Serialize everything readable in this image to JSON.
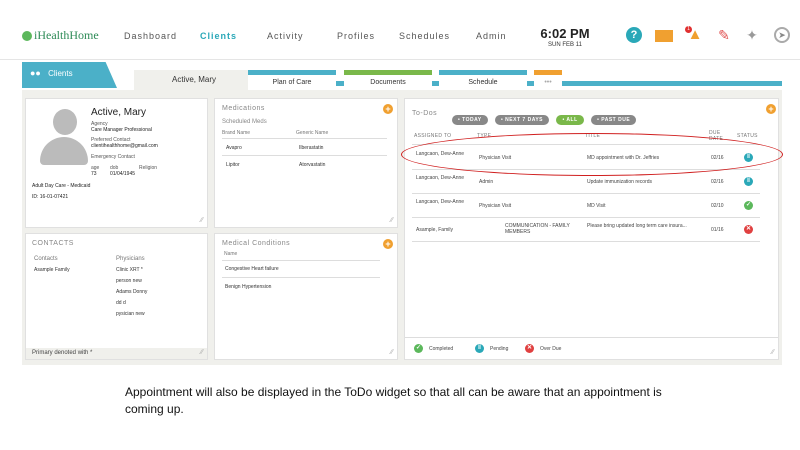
{
  "app": {
    "logo": "iHealthHome"
  },
  "nav": {
    "items": [
      "Dashboard",
      "Clients",
      "Activity",
      "Profiles",
      "Schedules",
      "Admin"
    ],
    "active": "Clients"
  },
  "clock": {
    "time": "6:02 PM",
    "date": "SUN FEB 11"
  },
  "notifications": {
    "bell_count": "1"
  },
  "tabs": {
    "clients": "Clients",
    "active_client": "Active, Mary",
    "subtabs": [
      {
        "label": "Plan of Care",
        "color": "#4bb0c8"
      },
      {
        "label": "Documents",
        "color": "#7ab84a"
      },
      {
        "label": "Schedule",
        "color": "#4bb0c8"
      },
      {
        "label": "•••",
        "color": "#f0a030"
      }
    ]
  },
  "profile": {
    "name": "Active, Mary",
    "agency_label": "Agency",
    "agency": "Care Manager Professional",
    "preferred_contact_label": "Preferred Contact",
    "preferred_contact": "clientihealthhome@gmail.com",
    "emergency_contact_label": "Emergency Contact",
    "age_label": "age",
    "age": "73",
    "dob_label": "dob",
    "dob": "01/04/1945",
    "religion_label": "Religion",
    "program": "Adult Day Care - Medicaid",
    "id": "ID: 16-01-07421"
  },
  "medications": {
    "title": "Medications",
    "subtitle": "Scheduled Meds",
    "col_brand": "Brand Name",
    "col_generic": "Generic Name",
    "rows": [
      {
        "brand": "Avapro",
        "generic": "Ilberastatin"
      },
      {
        "brand": "Lipitor",
        "generic": "Atorvastatin"
      }
    ]
  },
  "contacts": {
    "title": "CONTACTS",
    "col_contacts": "Contacts",
    "col_physicians": "Physicians",
    "contacts": [
      "Asample Family"
    ],
    "physicians": [
      "Clinic XRT *",
      "person new",
      "Adams Donny",
      "dd d",
      "pysician new"
    ],
    "footer": "Primary denoted with *"
  },
  "conditions": {
    "title": "Medical Conditions",
    "col_name": "Name",
    "rows": [
      "Congestive Heart failure",
      "Benign Hypertension"
    ]
  },
  "todos": {
    "title": "To-Dos",
    "filters": [
      {
        "label": "• TODAY",
        "active": false
      },
      {
        "label": "• NEXT 7 DAYS",
        "active": false
      },
      {
        "label": "• ALL",
        "active": true
      },
      {
        "label": "• PAST DUE",
        "active": false
      }
    ],
    "headers": {
      "assigned": "ASSIGNED TO",
      "type": "TYPE",
      "title": "TITLE",
      "due": "DUE",
      "due2": "DATE",
      "status": "STATUS"
    },
    "rows": [
      {
        "assigned": "Langcaon, Dew-Anne",
        "type": "Physician Visit",
        "title": "MD appointment with Dr. Jeffries",
        "due": "02/16",
        "status": "pending"
      },
      {
        "assigned": "Langcaon, Dew-Anne",
        "type": "Admin",
        "title": "Update immunization records",
        "due": "02/16",
        "status": "pending"
      },
      {
        "assigned": "Langcaon, Dew-Anne",
        "type": "Physician Visit",
        "title": "MD Visit",
        "due": "02/10",
        "status": "completed"
      },
      {
        "assigned": "Asample, Family",
        "type": "COMMUNICATION - FAMILY MEMBERS",
        "title": "Please bring updated long term care insura...",
        "due": "01/16",
        "status": "overdue"
      }
    ],
    "legend": {
      "completed": "Completed",
      "pending": "Pending",
      "overdue": "Over Due"
    }
  },
  "caption": "Appointment will also be displayed in the ToDo widget so that all can be aware that an appointment is coming up."
}
